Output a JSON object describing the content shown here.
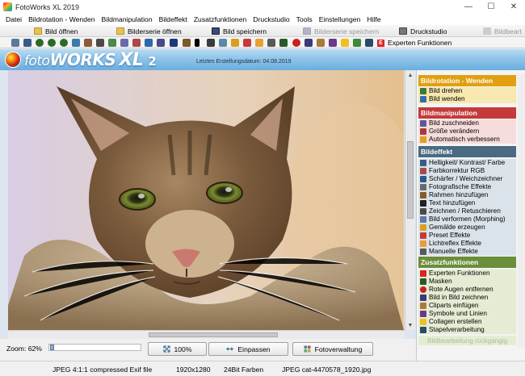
{
  "window": {
    "title": "FotoWorks XL 2019",
    "controls": [
      "—",
      "☐",
      "✕"
    ]
  },
  "menu": [
    "Datei",
    "Bildrotation - Wenden",
    "Bildmanipulation",
    "Bildeffekt",
    "Zusatzfunktionen",
    "Druckstudio",
    "Tools",
    "Einstellungen",
    "Hilfe"
  ],
  "toolbar": {
    "open_image": "Bild öffnen",
    "open_series": "Bilderserie öffnen",
    "save_image": "Bild speichern",
    "save_series": "Bilderserie speichern",
    "print_studio": "Druckstudio",
    "edit_cut": "Bildbeart",
    "expert_functions": "Experten Funktionen",
    "expert_icon_letter": "E"
  },
  "banner": {
    "brand_foto": "foto",
    "brand_works": "WORKS",
    "brand_xl": "XL",
    "brand_version": "2",
    "last_created": "Letztes Erstellungsdatum: 04.08.2019"
  },
  "image": {
    "subject": "cat photo",
    "colors": {
      "fur": "#8a6a48",
      "eyes": "#7a8a38"
    }
  },
  "zoom": {
    "label": "Zoom: 62%",
    "level_percent": 62
  },
  "buttons": {
    "zoom100": "100%",
    "fit": "Einpassen",
    "photo_manager": "Fotoverwaltung"
  },
  "status": {
    "format": "JPEG 4:1:1 compressed Exif file",
    "resolution": "1920x1280",
    "colors": "24Bit Farben",
    "filename": "JPEG cat-4470578_1920.jpg"
  },
  "panel": {
    "rotation": {
      "title": "Bildrotation - Wenden",
      "color": "#e0a010",
      "items": [
        "Bild drehen",
        "Bild wenden"
      ]
    },
    "manipulation": {
      "title": "Bildmanipulation",
      "color": "#c43a3a",
      "items": [
        "Bild zuschneiden",
        "Größe verändern",
        "Automatisch verbessern"
      ]
    },
    "effect": {
      "title": "Bildeffekt",
      "color": "#4a6a82",
      "items": [
        "Helligkeit/ Kontrast/ Farbe",
        "Farbkorrektur RGB",
        "Schärfer / Weichzeichner",
        "Fotografische Effekte",
        "Rahmen hinzufügen",
        "Text hinzufügen",
        "Zeichnen / Retuschieren",
        "Bild verformen (Morphing)",
        "Gemälde erzeugen",
        "Preset Effekte",
        "Lichtreflex Effekte",
        "Manuelle Effekte"
      ]
    },
    "extra": {
      "title": "Zusatzfunktionen",
      "color": "#6a8e3a",
      "items": [
        "Experten Funktionen",
        "Masken",
        "Rote Augen entfernen",
        "Bild in Bild zeichnen",
        "Cliparts einfügen",
        "Symbole und Linien",
        "Collagen erstellen",
        "Stapelverarbeitung"
      ],
      "undo": "Bildbearbeitung rückgängig"
    }
  }
}
